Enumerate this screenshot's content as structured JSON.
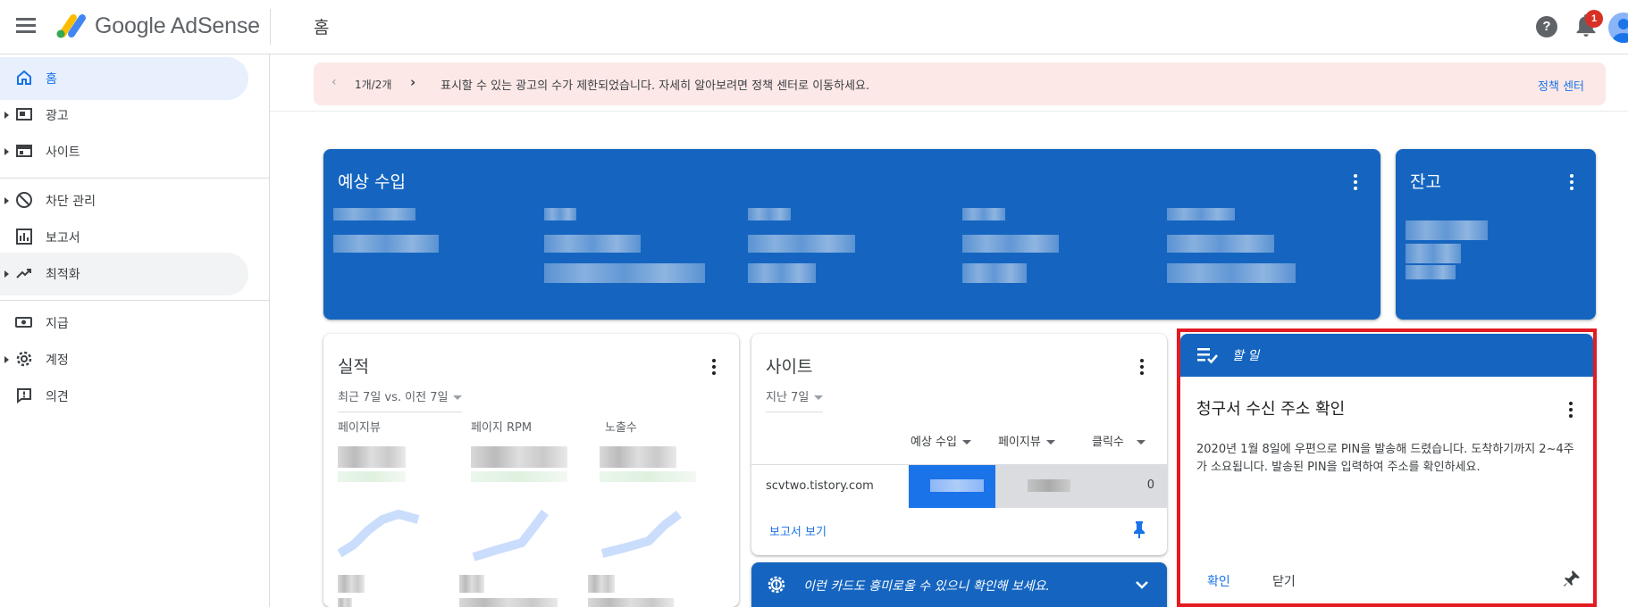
{
  "header": {
    "brand": "Google AdSense",
    "page_title": "홈",
    "help_label": "?",
    "notification_count": "1"
  },
  "sidebar": {
    "items": [
      {
        "label": "홈",
        "icon": "home-icon"
      },
      {
        "label": "광고",
        "icon": "ads-icon"
      },
      {
        "label": "사이트",
        "icon": "sites-icon"
      },
      {
        "label": "차단 관리",
        "icon": "block-icon"
      },
      {
        "label": "보고서",
        "icon": "reports-icon"
      },
      {
        "label": "최적화",
        "icon": "trending-icon"
      },
      {
        "label": "지급",
        "icon": "payments-icon"
      },
      {
        "label": "계정",
        "icon": "gear-icon"
      },
      {
        "label": "의견",
        "icon": "feedback-icon"
      }
    ]
  },
  "alert": {
    "pager": "1개/2개",
    "message": "표시할 수 있는 광고의 수가 제한되었습니다. 자세히 알아보려면 정책 센터로 이동하세요.",
    "link": "정책 센터"
  },
  "cards": {
    "earnings": {
      "title": "예상 수입"
    },
    "balance": {
      "title": "잔고"
    },
    "performance": {
      "title": "실적",
      "range": "최근 7일 vs. 이전 7일",
      "metrics": [
        "페이지뷰",
        "페이지 RPM",
        "노출수"
      ]
    },
    "sites": {
      "title": "사이트",
      "range": "지난 7일",
      "columns": [
        "예상 수입",
        "페이지뷰",
        "클릭수"
      ],
      "rows": [
        {
          "site": "scvtwo.tistory.com",
          "clicks": "0"
        }
      ],
      "report_link": "보고서 보기"
    },
    "interest": {
      "message": "이런 카드도 흥미로울 수 있으니 확인해 보세요."
    },
    "todo": {
      "header": "할 일",
      "title": "청구서 수신 주소 확인",
      "body": "2020년 1월 8일에 우편으로 PIN을 발송해 드렸습니다. 도착하기까지 2~4주가 소요됩니다. 발송된 PIN을 입력하여 주소를 확인하세요.",
      "confirm": "확인",
      "close": "닫기"
    }
  },
  "colors": {
    "primary_blue": "#1565c0",
    "accent_blue": "#1a73e8",
    "alert_bg": "#fce8e6",
    "highlight_red": "#e31b23"
  }
}
